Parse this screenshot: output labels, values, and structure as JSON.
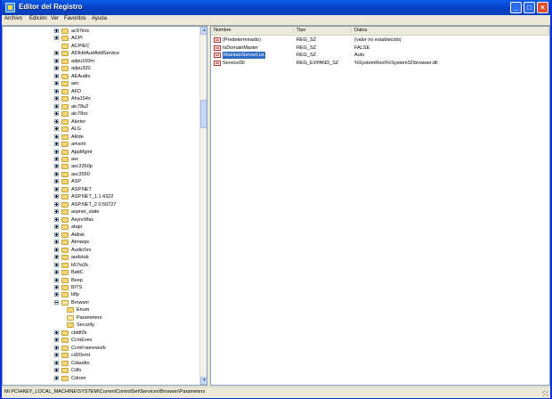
{
  "window": {
    "title": "Editor del Registro"
  },
  "titlebar": {
    "min": "_",
    "max": "□",
    "close": "×"
  },
  "menu": [
    "Archivo",
    "Edición",
    "Ver",
    "Favoritos",
    "Ayuda"
  ],
  "tree": [
    {
      "label": "ac97intc",
      "exp": "plus"
    },
    {
      "label": "ACPI",
      "exp": "plus"
    },
    {
      "label": "ACPIEC",
      "exp": "none"
    },
    {
      "label": "ADIHdAudAddService",
      "exp": "plus"
    },
    {
      "label": "adpu160m",
      "exp": "plus"
    },
    {
      "label": "adpu320",
      "exp": "plus"
    },
    {
      "label": "AEAudio",
      "exp": "plus"
    },
    {
      "label": "aec",
      "exp": "plus"
    },
    {
      "label": "AFD",
      "exp": "plus"
    },
    {
      "label": "Aha154x",
      "exp": "plus"
    },
    {
      "label": "aic78u2",
      "exp": "plus"
    },
    {
      "label": "aic78xx",
      "exp": "plus"
    },
    {
      "label": "Alerter",
      "exp": "plus"
    },
    {
      "label": "ALG",
      "exp": "plus"
    },
    {
      "label": "AliIde",
      "exp": "plus"
    },
    {
      "label": "amsint",
      "exp": "plus"
    },
    {
      "label": "AppMgmt",
      "exp": "plus"
    },
    {
      "label": "asc",
      "exp": "plus"
    },
    {
      "label": "asc3350p",
      "exp": "plus"
    },
    {
      "label": "asc3550",
      "exp": "plus"
    },
    {
      "label": "ASP",
      "exp": "plus"
    },
    {
      "label": "ASP.NET",
      "exp": "plus"
    },
    {
      "label": "ASP.NET_1.1.4322",
      "exp": "plus"
    },
    {
      "label": "ASP.NET_2.0.50727",
      "exp": "plus"
    },
    {
      "label": "aspnet_state",
      "exp": "plus"
    },
    {
      "label": "AsyncMac",
      "exp": "plus"
    },
    {
      "label": "atapi",
      "exp": "plus"
    },
    {
      "label": "Atdisk",
      "exp": "plus"
    },
    {
      "label": "Atmarpc",
      "exp": "plus"
    },
    {
      "label": "AudioSrv",
      "exp": "plus"
    },
    {
      "label": "audstub",
      "exp": "plus"
    },
    {
      "label": "b57w2k",
      "exp": "plus"
    },
    {
      "label": "BattC",
      "exp": "plus"
    },
    {
      "label": "Beep",
      "exp": "plus"
    },
    {
      "label": "BITS",
      "exp": "plus"
    },
    {
      "label": "blfp",
      "exp": "plus"
    },
    {
      "label": "Browser",
      "exp": "minus",
      "open": true
    },
    {
      "label": "Enum",
      "exp": "none",
      "child": true
    },
    {
      "label": "Parameters",
      "exp": "none",
      "child": true,
      "open": true
    },
    {
      "label": "Security",
      "exp": "none",
      "child": true
    },
    {
      "label": "cbidf2k",
      "exp": "plus"
    },
    {
      "label": "CcmExec",
      "exp": "plus"
    },
    {
      "label": "CcmFramework",
      "exp": "plus"
    },
    {
      "label": "cd20xrnt",
      "exp": "plus"
    },
    {
      "label": "Cdaudio",
      "exp": "plus"
    },
    {
      "label": "Cdfs",
      "exp": "plus"
    },
    {
      "label": "Cdrom",
      "exp": "plus"
    }
  ],
  "list": {
    "columns": [
      "Nombre",
      "Tipo",
      "Datos"
    ],
    "rows": [
      {
        "name": "(Predeterminado)",
        "type": "REG_SZ",
        "data": "(valor no establecido)"
      },
      {
        "name": "IsDomainMaster",
        "type": "REG_SZ",
        "data": "FALSE"
      },
      {
        "name": "MaintainServerList",
        "type": "REG_SZ",
        "data": "Auto",
        "selected": true
      },
      {
        "name": "ServiceDll",
        "type": "REG_EXPAND_SZ",
        "data": "%SystemRoot%\\System32\\browser.dll"
      }
    ],
    "icon": "ab"
  },
  "status": "Mi PC\\HKEY_LOCAL_MACHINE\\SYSTEM\\CurrentControlSet\\Services\\Browser\\Parameters"
}
